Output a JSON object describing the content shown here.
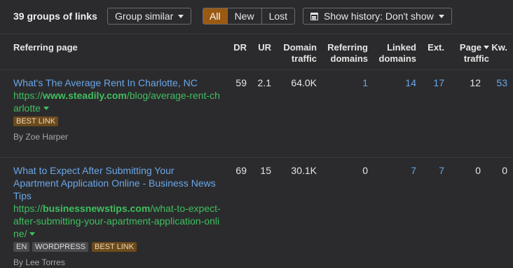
{
  "toolbar": {
    "groups_count": "39 groups of links",
    "group_similar": "Group similar",
    "filters": [
      "All",
      "New",
      "Lost"
    ],
    "active_filter": "All",
    "show_history": "Show history: Don't show"
  },
  "headers": {
    "referring_page": "Referring page",
    "dr": "DR",
    "ur": "UR",
    "domain_traffic_1": "Domain",
    "domain_traffic_2": "traffic",
    "referring_domains_1": "Referring",
    "referring_domains_2": "domains",
    "linked_domains_1": "Linked",
    "linked_domains_2": "domains",
    "ext": "Ext.",
    "page_traffic_1": "Page",
    "page_traffic_2": "traffic",
    "kw": "Kw."
  },
  "rows": [
    {
      "title": "What's The Average Rent In Charlotte, NC",
      "url_prefix": "https://",
      "url_domain": "www.steadily.com",
      "url_path": "/blog/average-rent-charlotte",
      "badges": [
        "BEST LINK"
      ],
      "author": "By Zoe Harper",
      "dr": "59",
      "ur": "2.1",
      "domain_traffic": "64.0K",
      "referring_domains": "1",
      "linked_domains": "14",
      "ext": "17",
      "page_traffic": "12",
      "kw": "53"
    },
    {
      "title_lines": [
        "What to Expect After Submitting Your",
        "Apartment Application Online - Business News",
        "Tips"
      ],
      "url_prefix": "https://",
      "url_domain": "businessnewstips.com",
      "url_path": "/what-to-expect-after-submitting-your-apartment-application-online/",
      "badges": [
        "EN",
        "WORDPRESS",
        "BEST LINK"
      ],
      "author": "By Lee Torres",
      "dr": "69",
      "ur": "15",
      "domain_traffic": "30.1K",
      "referring_domains": "0",
      "linked_domains": "7",
      "ext": "7",
      "page_traffic": "0",
      "kw": "0"
    }
  ]
}
